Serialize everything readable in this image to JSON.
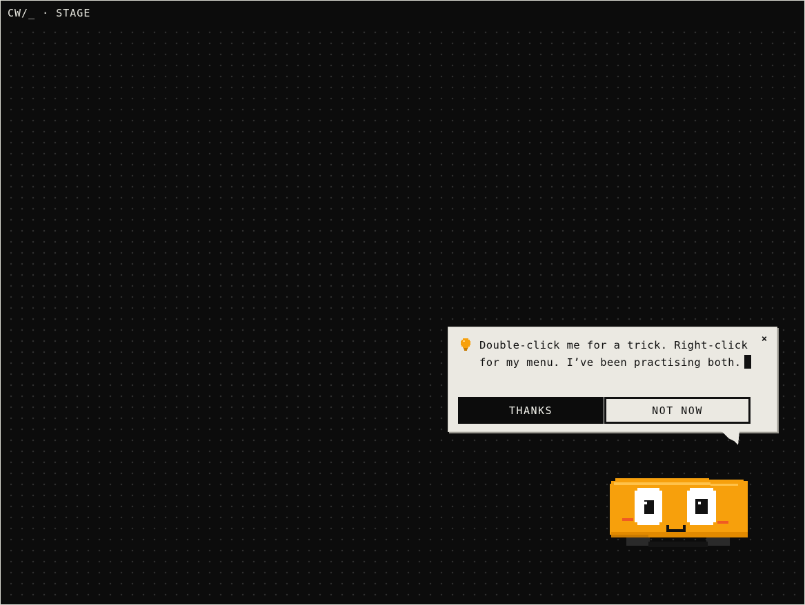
{
  "header": {
    "title": "CW/_ · STAGE"
  },
  "bubble": {
    "icon": "lightbulb-icon",
    "message": "Double-click me for a trick. Right-click for my menu. I’ve been practising both.",
    "close_label": "×",
    "buttons": {
      "primary_label": "THANKS",
      "secondary_label": "NOT NOW"
    }
  },
  "mascot": {
    "name": "mascot-character",
    "body_color": "#f7a00c"
  },
  "colors": {
    "background": "#0c0c0c",
    "bubble_bg": "#ebe9e2",
    "accent": "#f7a00c",
    "text_dark": "#111111",
    "text_light": "#e8e8e0"
  }
}
